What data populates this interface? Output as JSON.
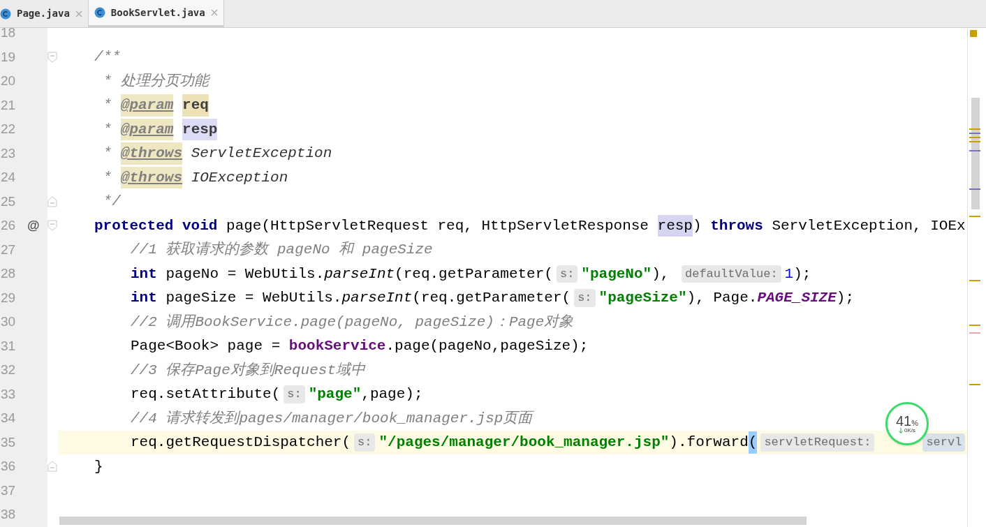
{
  "tabs": [
    {
      "label": "Page.java",
      "selected": false
    },
    {
      "label": "BookServlet.java",
      "selected": true
    }
  ],
  "lines": [
    {
      "number": "18",
      "current": false,
      "kind": "plain"
    },
    {
      "number": "19",
      "current": false,
      "kind": "fold_start",
      "in_body": false,
      "tokens": [
        {
          "kind": "comment",
          "text": "/**"
        }
      ]
    },
    {
      "number": "20",
      "current": false,
      "kind": "plain",
      "in_body": false,
      "tokens": [
        {
          "kind": "comment",
          "text": " * 处理分页功能"
        }
      ]
    },
    {
      "number": "21",
      "current": false,
      "kind": "plain",
      "in_body": false,
      "tokens": [
        {
          "kind": "comment",
          "text": " * "
        },
        {
          "kind": "doctag",
          "text": "@param"
        },
        {
          "kind": "docparam",
          "text": "req"
        }
      ]
    },
    {
      "number": "22",
      "current": false,
      "kind": "plain",
      "in_body": false,
      "tokens": [
        {
          "kind": "comment",
          "text": " * "
        },
        {
          "kind": "doctag",
          "text": "@param"
        },
        {
          "kind": "docparam_usage",
          "text": "resp"
        }
      ]
    },
    {
      "number": "23",
      "current": false,
      "kind": "plain",
      "in_body": false,
      "tokens": [
        {
          "kind": "comment",
          "text": " * "
        },
        {
          "kind": "doctag",
          "text": "@throws"
        },
        {
          "kind": "docref",
          "text": "ServletException"
        }
      ]
    },
    {
      "number": "24",
      "current": false,
      "kind": "plain",
      "in_body": false,
      "tokens": [
        {
          "kind": "comment",
          "text": " * "
        },
        {
          "kind": "doctag",
          "text": "@throws"
        },
        {
          "kind": "docref",
          "text": "IOException"
        }
      ]
    },
    {
      "number": "25",
      "current": false,
      "kind": "fold_end",
      "in_body": false,
      "tokens": [
        {
          "kind": "comment",
          "text": " */"
        }
      ]
    },
    {
      "number": "26",
      "current": false,
      "kind": "fold_start",
      "in_body": false,
      "gutter_mark": "@",
      "tokens": [
        {
          "kind": "keyword",
          "text": "protected void"
        },
        {
          "kind": "plain",
          "text": " page(HttpServletRequest req, HttpServletResponse "
        },
        {
          "kind": "usage",
          "text": "resp"
        },
        {
          "kind": "plain",
          "text": ") "
        },
        {
          "kind": "keyword",
          "text": "throws"
        },
        {
          "kind": "plain",
          "text": " ServletException, IOEx"
        }
      ]
    },
    {
      "number": "27",
      "current": false,
      "kind": "plain",
      "in_body": true,
      "tokens": [
        {
          "kind": "comment",
          "text": "//1 获取请求的参数 pageNo 和 pageSize"
        }
      ]
    },
    {
      "number": "28",
      "current": false,
      "kind": "plain",
      "in_body": true,
      "tokens": [
        {
          "kind": "keyword",
          "text": "int"
        },
        {
          "kind": "plain",
          "text": " pageNo = WebUtils."
        },
        {
          "kind": "italic",
          "text": "parseInt"
        },
        {
          "kind": "plain",
          "text": "(req.getParameter("
        },
        {
          "kind": "hint",
          "text": "s:"
        },
        {
          "kind": "string",
          "text": "\"pageNo\""
        },
        {
          "kind": "plain",
          "text": "), "
        },
        {
          "kind": "hint",
          "text": "defaultValue:"
        },
        {
          "kind": "number",
          "text": "1"
        },
        {
          "kind": "plain",
          "text": ");"
        }
      ]
    },
    {
      "number": "29",
      "current": false,
      "kind": "plain",
      "in_body": true,
      "tokens": [
        {
          "kind": "keyword",
          "text": "int"
        },
        {
          "kind": "plain",
          "text": " pageSize = WebUtils."
        },
        {
          "kind": "italic",
          "text": "parseInt"
        },
        {
          "kind": "plain",
          "text": "(req.getParameter("
        },
        {
          "kind": "hint",
          "text": "s:"
        },
        {
          "kind": "string",
          "text": "\"pageSize\""
        },
        {
          "kind": "plain",
          "text": "), Page."
        },
        {
          "kind": "static",
          "text": "PAGE_SIZE"
        },
        {
          "kind": "plain",
          "text": ");"
        }
      ]
    },
    {
      "number": "30",
      "current": false,
      "kind": "plain",
      "in_body": true,
      "tokens": [
        {
          "kind": "comment",
          "text": "//2 调用BookService.page(pageNo, pageSize)：Page对象"
        }
      ]
    },
    {
      "number": "31",
      "current": false,
      "kind": "plain",
      "in_body": true,
      "tokens": [
        {
          "kind": "plain",
          "text": "Page<Book> page = "
        },
        {
          "kind": "field",
          "text": "bookService"
        },
        {
          "kind": "plain",
          "text": ".page(pageNo,pageSize);"
        }
      ]
    },
    {
      "number": "32",
      "current": false,
      "kind": "plain",
      "in_body": true,
      "tokens": [
        {
          "kind": "comment",
          "text": "//3 保存Page对象到Request域中"
        }
      ]
    },
    {
      "number": "33",
      "current": false,
      "kind": "plain",
      "in_body": true,
      "tokens": [
        {
          "kind": "plain",
          "text": "req.setAttribute("
        },
        {
          "kind": "hint",
          "text": "s:"
        },
        {
          "kind": "string",
          "text": "\"page\""
        },
        {
          "kind": "plain",
          "text": ",page);"
        }
      ]
    },
    {
      "number": "34",
      "current": false,
      "kind": "plain",
      "in_body": true,
      "tokens": [
        {
          "kind": "comment",
          "text": "//4 请求转发到pages/manager/book_manager.jsp页面"
        }
      ]
    },
    {
      "number": "35",
      "current": true,
      "kind": "plain",
      "in_body": true,
      "tokens": [
        {
          "kind": "plain",
          "text": "req.getRequestDispatcher("
        },
        {
          "kind": "hint",
          "text": "s:"
        },
        {
          "kind": "string",
          "text": "\"/pages/manager/book_manager.jsp\""
        },
        {
          "kind": "plain",
          "text": ").forward"
        },
        {
          "kind": "brace",
          "text": "("
        },
        {
          "kind": "hint",
          "text": "servletRequest:"
        },
        {
          "kind": "hint_usage",
          "text": "servl"
        }
      ]
    },
    {
      "number": "36",
      "current": false,
      "kind": "fold_end",
      "in_body": false,
      "tokens": [
        {
          "kind": "plain",
          "text": "}"
        }
      ]
    },
    {
      "number": "37",
      "current": false,
      "kind": "plain"
    },
    {
      "number": "38",
      "current": false,
      "kind": "plain"
    }
  ],
  "widget": {
    "percent": "41",
    "unit": "%",
    "speed": "0K/s"
  }
}
